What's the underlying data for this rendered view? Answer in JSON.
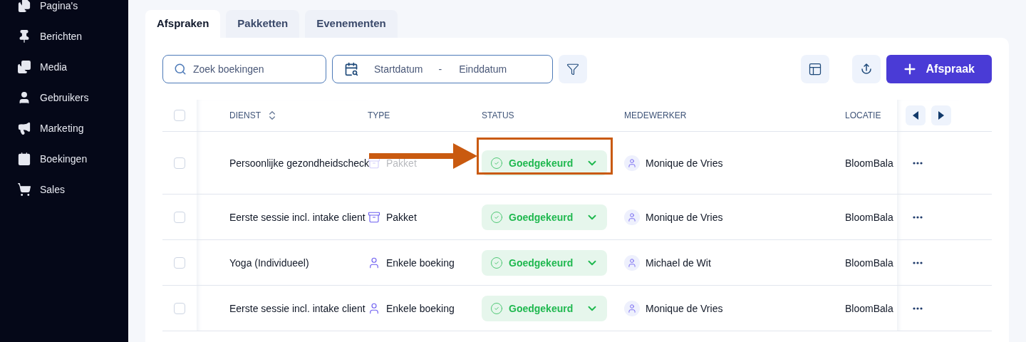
{
  "sidebar": {
    "items": [
      {
        "label": "Pagina's",
        "kind": "pages"
      },
      {
        "label": "Berichten",
        "kind": "posts"
      },
      {
        "label": "Media",
        "kind": "media"
      },
      {
        "label": "Gebruikers",
        "kind": "users"
      },
      {
        "label": "Marketing",
        "kind": "marketing"
      },
      {
        "label": "Boekingen",
        "kind": "bookings"
      },
      {
        "label": "Sales",
        "kind": "sales"
      }
    ]
  },
  "tabs": [
    {
      "label": "Afspraken",
      "selected": true
    },
    {
      "label": "Pakketten",
      "selected": false
    },
    {
      "label": "Evenementen",
      "selected": false
    }
  ],
  "toolbar": {
    "search": {
      "placeholder": "Zoek boekingen"
    },
    "date_range": {
      "start_placeholder": "Startdatum",
      "separator": "-",
      "end_placeholder": "Einddatum"
    },
    "add_button": "Afspraak"
  },
  "table": {
    "select_all_checked": false,
    "columns": [
      "DIENST",
      "TYPE",
      "STATUS",
      "MEDEWERKER",
      "LOCATIE"
    ],
    "rows": [
      {
        "checked": false,
        "service": "Persoonlijke gezondheidscheck",
        "type": {
          "kind": "package",
          "label": "Pakket"
        },
        "status": "Goedgekeurd",
        "employee": "Monique de Vries",
        "location": "BloomBala",
        "highlighted": true
      },
      {
        "checked": false,
        "service": "Eerste sessie incl. intake client",
        "type": {
          "kind": "package",
          "label": "Pakket"
        },
        "status": "Goedgekeurd",
        "employee": "Monique de Vries",
        "location": "BloomBala",
        "highlighted": false
      },
      {
        "checked": false,
        "service": "Yoga (Individueel)",
        "type": {
          "kind": "single",
          "label": "Enkele boeking"
        },
        "status": "Goedgekeurd",
        "employee": "Michael de Wit",
        "location": "BloomBala",
        "highlighted": false
      },
      {
        "checked": false,
        "service": "Eerste sessie incl. intake client",
        "type": {
          "kind": "single",
          "label": "Enkele boeking"
        },
        "status": "Goedgekeurd",
        "employee": "Monique de Vries",
        "location": "BloomBala",
        "highlighted": false
      }
    ]
  }
}
